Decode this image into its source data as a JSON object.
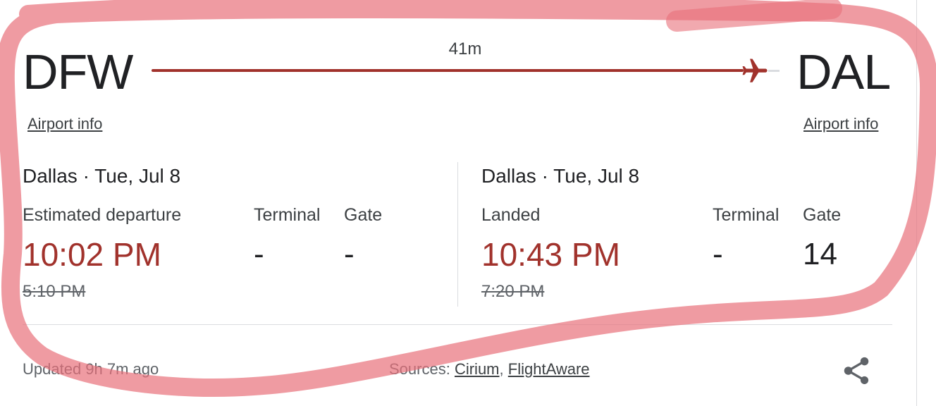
{
  "origin": {
    "code": "DFW",
    "airport_info": "Airport info",
    "city_date": "Dallas · Tue, Jul 8",
    "status_label": "Estimated departure",
    "time": "10:02 PM",
    "scheduled_time": "5:10 PM",
    "terminal_label": "Terminal",
    "terminal": "-",
    "gate_label": "Gate",
    "gate": "-"
  },
  "destination": {
    "code": "DAL",
    "airport_info": "Airport info",
    "city_date": "Dallas · Tue, Jul 8",
    "status_label": "Landed",
    "time": "10:43 PM",
    "scheduled_time": "7:20 PM",
    "terminal_label": "Terminal",
    "terminal": "-",
    "gate_label": "Gate",
    "gate": "14"
  },
  "route": {
    "duration": "41m",
    "progress": 0.97
  },
  "footer": {
    "updated": "Updated 9h 7m ago",
    "sources_label": "Sources:",
    "source1": "Cirium",
    "separator": ",",
    "source2": "FlightAware"
  },
  "icons": {
    "plane": "airplane-icon",
    "share": "share-icon"
  },
  "colors": {
    "accent": "#a1322c",
    "annotation": "#e8707a",
    "text": "#202124",
    "muted": "#5f6368"
  }
}
